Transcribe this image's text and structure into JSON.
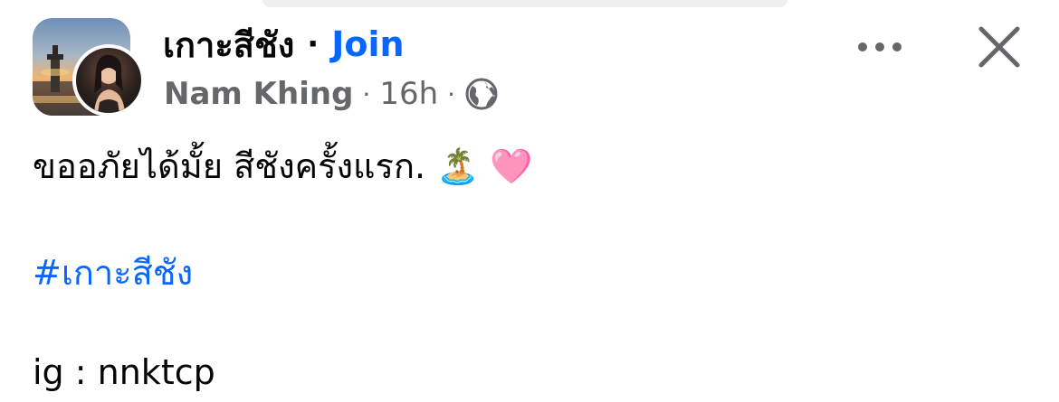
{
  "post": {
    "group_name": "เกาะสีชัง",
    "title_separator": "·",
    "join_label": "Join",
    "author": "Nam Khing",
    "meta_separator": "·",
    "time_ago": "16h",
    "privacy_icon": "globe-icon",
    "body_text": "ขออภัยได้มั้ย สีชังครั้งแรก.",
    "emojis": [
      "🏝️",
      "🩷"
    ],
    "hashtag": "#เกาะสีชัง",
    "ig_line": "ig : nnktcp"
  },
  "icons": {
    "more": "more-horizontal-icon",
    "close": "close-icon"
  },
  "colors": {
    "link": "#0866ff",
    "secondary_text": "#65676b",
    "primary_text": "#050505"
  }
}
